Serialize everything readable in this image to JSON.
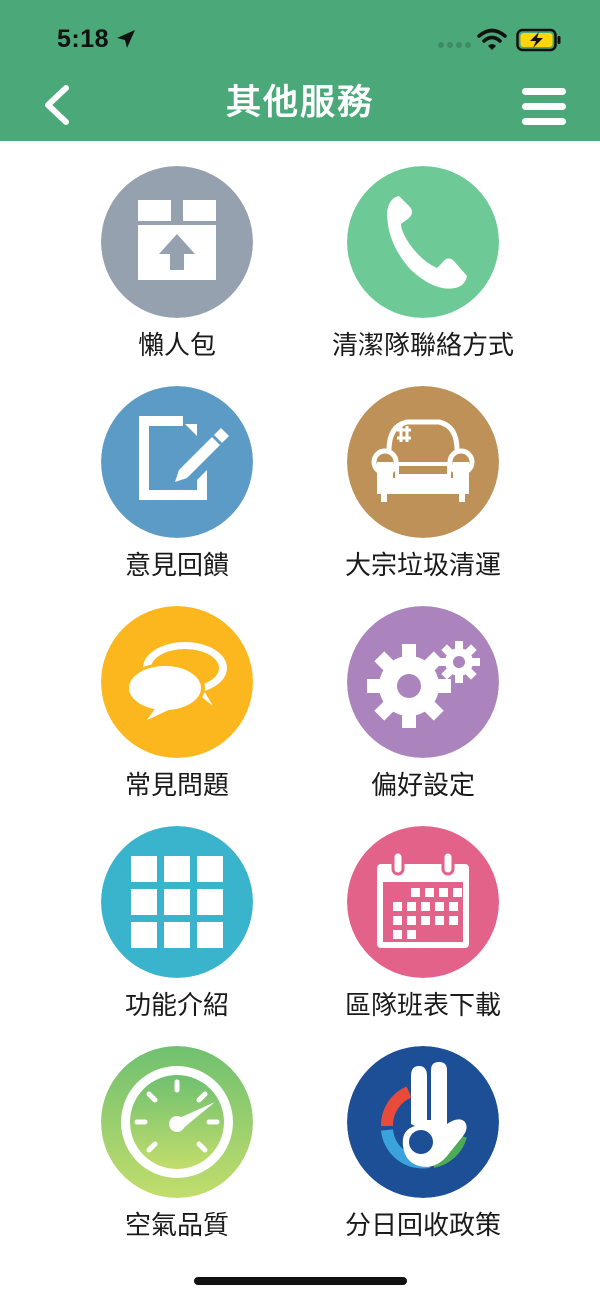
{
  "status_bar": {
    "time": "5:18"
  },
  "header": {
    "title": "其他服務",
    "back_icon": "chevron-left-icon",
    "menu_icon": "hamburger-menu-icon",
    "background": "#4aa879"
  },
  "services": [
    {
      "label": "懶人包",
      "icon": "box-upload-icon",
      "color": "#95a1ae"
    },
    {
      "label": "清潔隊聯絡方式",
      "icon": "phone-icon",
      "color": "#6dca97"
    },
    {
      "label": "意見回饋",
      "icon": "edit-document-icon",
      "color": "#5b9bc6"
    },
    {
      "label": "大宗垃圾清運",
      "icon": "sofa-icon",
      "color": "#bd9158"
    },
    {
      "label": "常見問題",
      "icon": "speech-bubbles-icon",
      "color": "#fcb71e"
    },
    {
      "label": "偏好設定",
      "icon": "gears-icon",
      "color": "#ac84bd"
    },
    {
      "label": "功能介紹",
      "icon": "grid-icon",
      "color": "#3ab3cc"
    },
    {
      "label": "區隊班表下載",
      "icon": "calendar-icon",
      "color": "#e2628a"
    },
    {
      "label": "空氣品質",
      "icon": "gauge-icon",
      "color": "#96cf6c"
    },
    {
      "label": "分日回收政策",
      "icon": "recycling-policy-logo-icon",
      "color": "#1c4f96"
    }
  ]
}
